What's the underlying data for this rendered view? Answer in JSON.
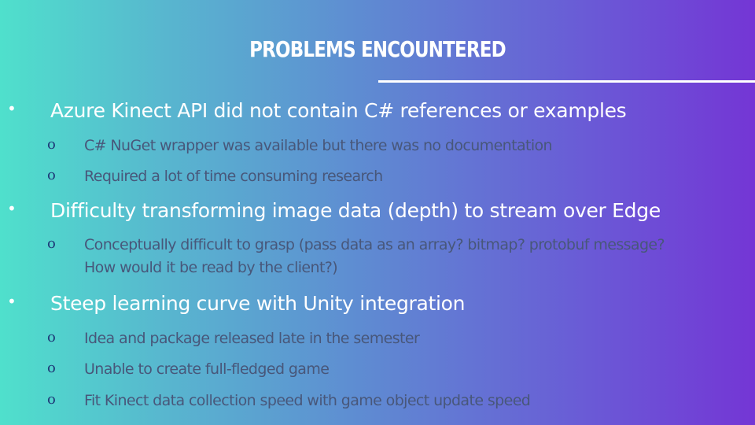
{
  "slide": {
    "title": "PROBLEMS ENCOUNTERED",
    "bullets": [
      {
        "marker": "•",
        "text": "Azure Kinect API did not contain C# references or examples",
        "subs": [
          {
            "marker": "o",
            "text": "C# NuGet wrapper was available but there was no documentation"
          },
          {
            "marker": "o",
            "text": "Required a lot of time consuming research"
          }
        ]
      },
      {
        "marker": "•",
        "text": "Difficulty transforming image data (depth) to stream over Edge",
        "subs": [
          {
            "marker": "o",
            "text": "Conceptually difficult to grasp (pass data as an array? bitmap? protobuf message? How would it be read by the client?)"
          }
        ]
      },
      {
        "marker": "•",
        "text": "Steep learning curve with Unity integration",
        "subs": [
          {
            "marker": "o",
            "text": "Idea and package released late in the semester"
          },
          {
            "marker": "o",
            "text": "Unable to create full-fledged game"
          },
          {
            "marker": "o",
            "text": "Fit Kinect data collection speed with game object update speed"
          }
        ]
      }
    ]
  },
  "colors": {
    "gradient_start": "#4fe0cc",
    "gradient_end": "#7436d5",
    "heading_text": "#ffffff",
    "sub_text": "#48577a"
  }
}
